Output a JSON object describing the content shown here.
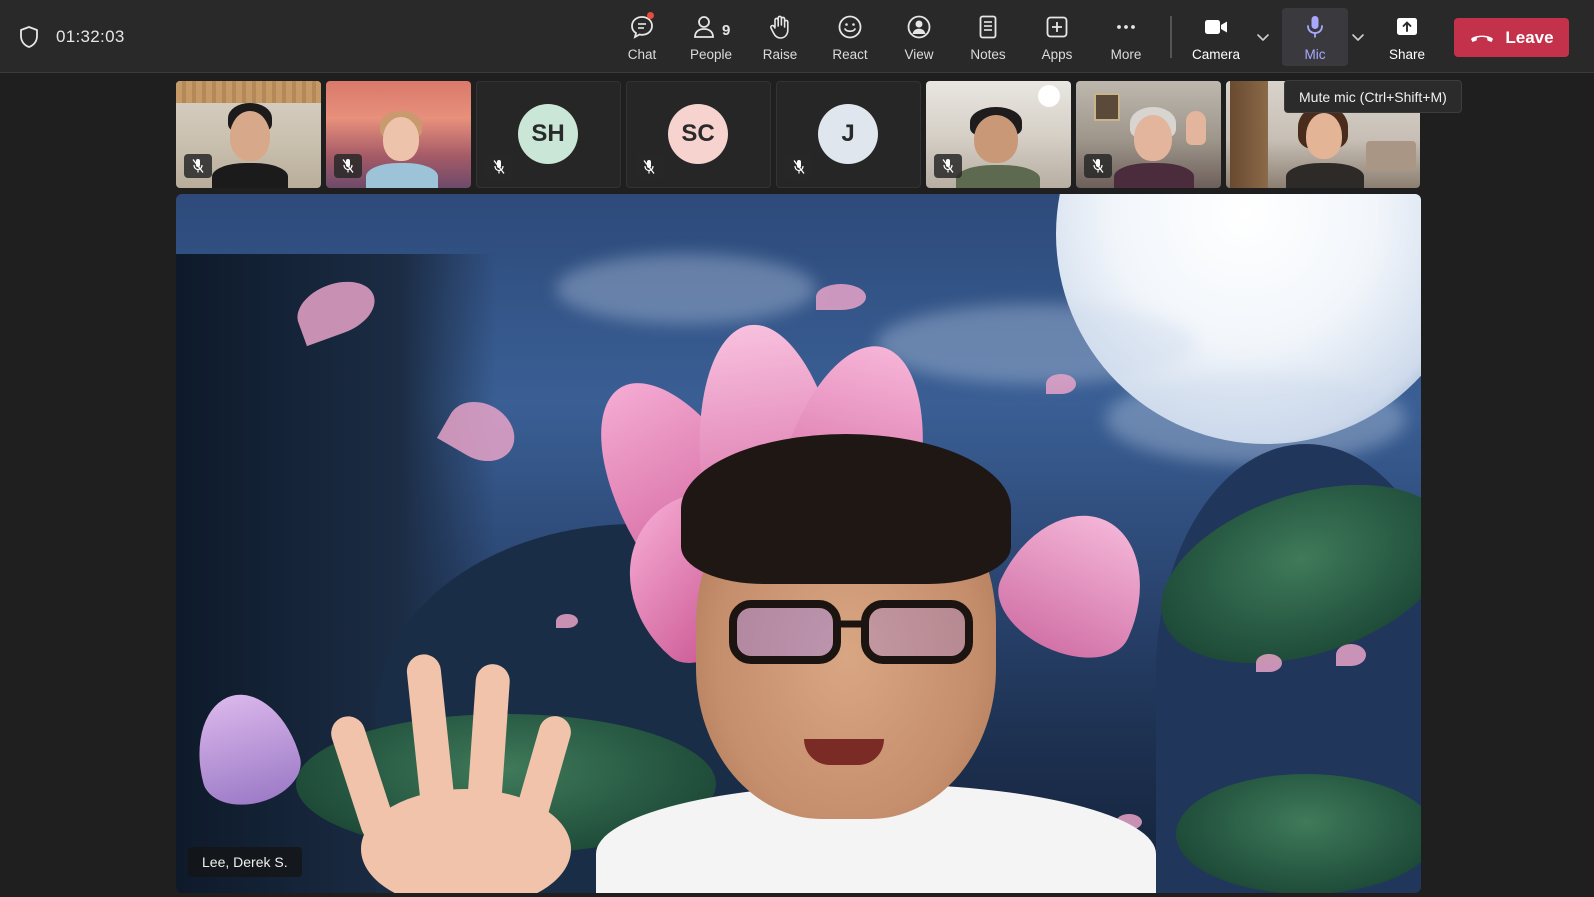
{
  "meeting": {
    "timer": "01:32:03"
  },
  "toolbar": {
    "chat_label": "Chat",
    "people_label": "People",
    "people_count": "9",
    "raise_label": "Raise",
    "react_label": "React",
    "view_label": "View",
    "notes_label": "Notes",
    "apps_label": "Apps",
    "more_label": "More",
    "camera_label": "Camera",
    "mic_label": "Mic",
    "share_label": "Share",
    "leave_label": "Leave"
  },
  "tooltip": {
    "text": "Mute mic (Ctrl+Shift+M)"
  },
  "participants": [
    {
      "type": "video"
    },
    {
      "type": "video"
    },
    {
      "type": "avatar",
      "initials": "SH",
      "color": "#c9e6d6"
    },
    {
      "type": "avatar",
      "initials": "SC",
      "color": "#f6d3cf"
    },
    {
      "type": "avatar",
      "initials": "J",
      "color": "#dfe6ee"
    },
    {
      "type": "video"
    },
    {
      "type": "video"
    },
    {
      "type": "video"
    }
  ],
  "stage": {
    "speaker_name": "Lee, Derek S."
  },
  "colors": {
    "accent": "#a8a8ff",
    "leave": "#c4314b",
    "notification_dot": "#e74c3c"
  }
}
